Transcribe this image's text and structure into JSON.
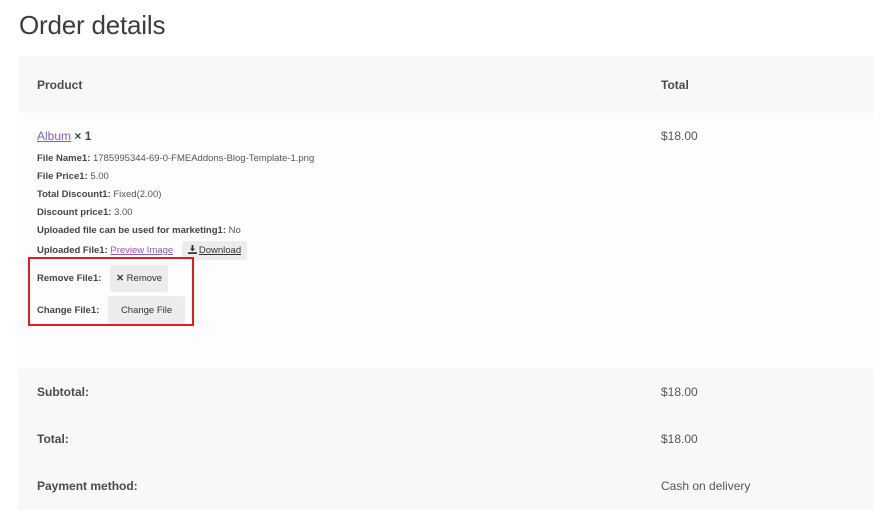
{
  "page": {
    "title": "Order details"
  },
  "table": {
    "headers": {
      "product": "Product",
      "total": "Total"
    },
    "item": {
      "name": "Album",
      "quantity": "× 1",
      "price": "$18.00",
      "meta": [
        {
          "label": "File Name1:",
          "value": "1785995344-69-0-FMEAddons-Blog-Template-1.png"
        },
        {
          "label": "File Price1:",
          "value": "5.00"
        },
        {
          "label": "Total Discount1:",
          "value": "Fixed(2.00)"
        },
        {
          "label": "Discount price1:",
          "value": "3.00"
        },
        {
          "label": "Uploaded file can be used for marketing1:",
          "value": "No"
        }
      ],
      "uploaded_label": "Uploaded File1:",
      "preview_link": "Preview Image",
      "download_label": "Download",
      "remove_label": "Remove File1:",
      "remove_button": "Remove",
      "change_label": "Change File1:",
      "change_button": "Change File"
    },
    "totals": [
      {
        "label": "Subtotal:",
        "value": "$18.00"
      },
      {
        "label": "Total:",
        "value": "$18.00"
      },
      {
        "label": "Payment method:",
        "value": "Cash on delivery"
      }
    ]
  },
  "colors": {
    "highlight": "#e21b26",
    "link": "#8b5da8"
  },
  "icons": {
    "download": "download-icon",
    "remove": "x-icon"
  }
}
